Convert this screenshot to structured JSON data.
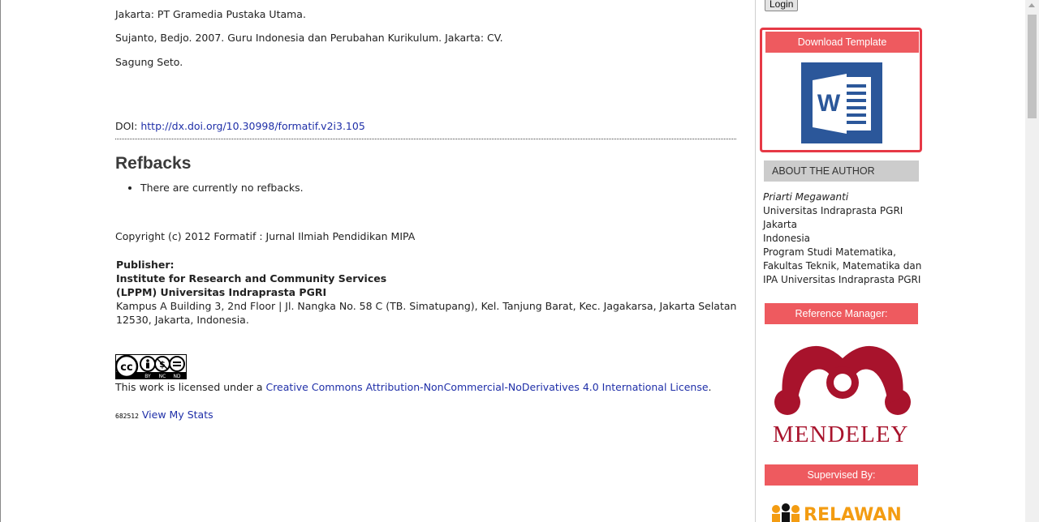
{
  "references": [
    "Jakarta: PT Gramedia Pustaka Utama.",
    "Sujanto, Bedjo. 2007. Guru Indonesia dan Perubahan Kurikulum. Jakarta: CV.",
    "Sagung Seto."
  ],
  "doi": {
    "label": "DOI: ",
    "link": "http://dx.doi.org/10.30998/formatif.v2i3.105"
  },
  "refbacks": {
    "heading": "Refbacks",
    "items": [
      "There are currently no refbacks."
    ]
  },
  "copyright": "Copyright (c) 2012 Formatif : Jurnal Ilmiah Pendidikan MIPA",
  "publisher": {
    "label": "Publisher:",
    "line1": "Institute for Research and Community Services",
    "line2": "(LPPM) Universitas Indraprasta PGRI",
    "address": "Kampus A Building 3, 2nd Floor | Jl. Nangka No. 58 C (TB. Simatupang), Kel. Tanjung Barat, Kec. Jagakarsa, Jakarta Selatan 12530, Jakarta, Indonesia."
  },
  "license": {
    "prefix": "This work is licensed under a ",
    "link": "Creative Commons Attribution-NonCommercial-NoDerivatives 4.0 International License",
    "suffix": ".",
    "badge_icon": "cc-by-nc-nd-badge"
  },
  "stats": {
    "counter": "682512",
    "link": "View My Stats"
  },
  "sidebar": {
    "login_label": "Login",
    "download_template": "Download Template",
    "template_icon": "ms-word-icon",
    "about_author": "ABOUT THE AUTHOR",
    "author": {
      "name": "Priarti Megawanti",
      "lines": [
        "Universitas Indraprasta PGRI",
        "Jakarta",
        "Indonesia",
        "Program Studi Matematika,",
        "Fakultas Teknik, Matematika dan",
        "IPA Universitas Indraprasta PGRI"
      ]
    },
    "reference_manager": "Reference Manager:",
    "mendeley_logo": "MENDELEY",
    "supervised_by": "Supervised By:",
    "relawan_logo": "RELAWAN"
  },
  "colors": {
    "accent_red": "#ee5a5f",
    "border_red": "#e63946",
    "link_blue": "#1f2fa8",
    "mendeley_red": "#a8132c",
    "word_blue": "#2b579a"
  }
}
